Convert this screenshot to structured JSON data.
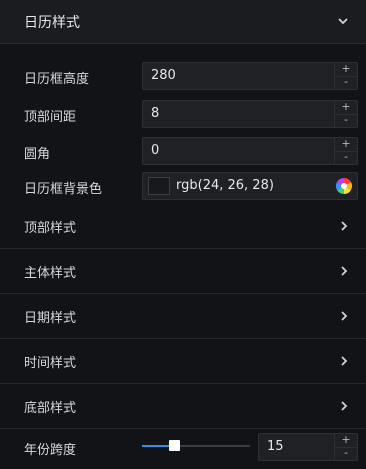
{
  "header": {
    "title": "日历样式",
    "chevron_icon": "chevron-down-icon"
  },
  "fields": {
    "calendar_height": {
      "label": "日历框高度",
      "value": "280",
      "plus": "+",
      "minus": "-"
    },
    "top_spacing": {
      "label": "顶部间距",
      "value": "8",
      "plus": "+",
      "minus": "-"
    },
    "corner_radius": {
      "label": "圆角",
      "value": "0",
      "plus": "+",
      "minus": "-"
    },
    "background_color": {
      "label": "日历框背景色",
      "value": "rgb(24, 26, 28)",
      "swatch_color": "#18191c"
    }
  },
  "sections": [
    {
      "label": "顶部样式",
      "icon": "chevron-right-icon"
    },
    {
      "label": "主体样式",
      "icon": "chevron-right-icon"
    },
    {
      "label": "日期样式",
      "icon": "chevron-right-icon"
    },
    {
      "label": "时间样式",
      "icon": "chevron-right-icon"
    },
    {
      "label": "底部样式",
      "icon": "chevron-right-icon"
    }
  ],
  "year_span": {
    "label": "年份跨度",
    "value": "15",
    "slider_fraction": 0.28,
    "plus": "+",
    "minus": "-"
  },
  "colors": {
    "accent": "#3c8cf0",
    "background": "#121316",
    "header_background": "#1b1c20"
  }
}
